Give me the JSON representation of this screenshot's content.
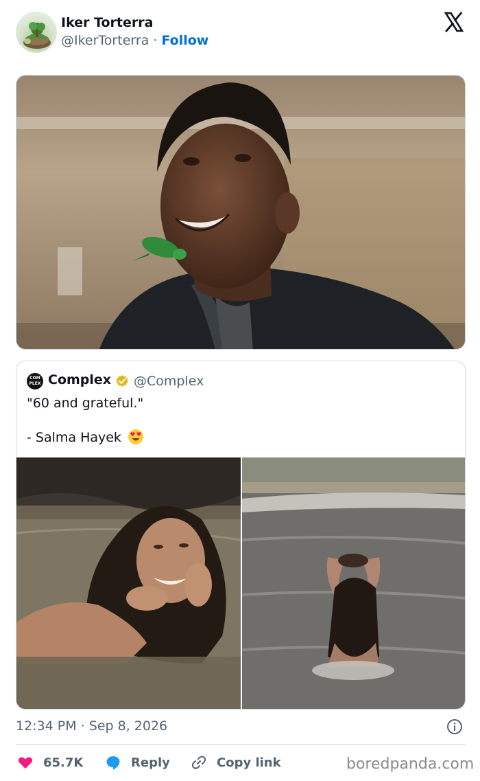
{
  "author": {
    "name": "Iker Torterra",
    "handle": "@IkerTorterra",
    "separator": "·",
    "follow_label": "Follow",
    "avatar_icon": "torterra-avatar-icon"
  },
  "platform_icon": "x-logo-icon",
  "quoted": {
    "name": "Complex",
    "logo_text": "COM PLEX",
    "verified_icon": "verified-gold-badge-icon",
    "handle": "@Complex",
    "text_line1": "\"60 and grateful.\"",
    "text_line2": "- Salma Hayek",
    "emoji": "heart-eyes-emoji-icon"
  },
  "meta": {
    "timestamp": "12:34 PM · Sep 8, 2026",
    "info_icon": "info-icon"
  },
  "actions": {
    "like_count": "65.7K",
    "reply_label": "Reply",
    "copy_label": "Copy link"
  },
  "watermark": "boredpanda.com",
  "colors": {
    "link": "#006fd6",
    "like": "#f91880",
    "reply": "#1d9bf0",
    "secondary_text": "#536471",
    "border": "#cfd9de"
  }
}
